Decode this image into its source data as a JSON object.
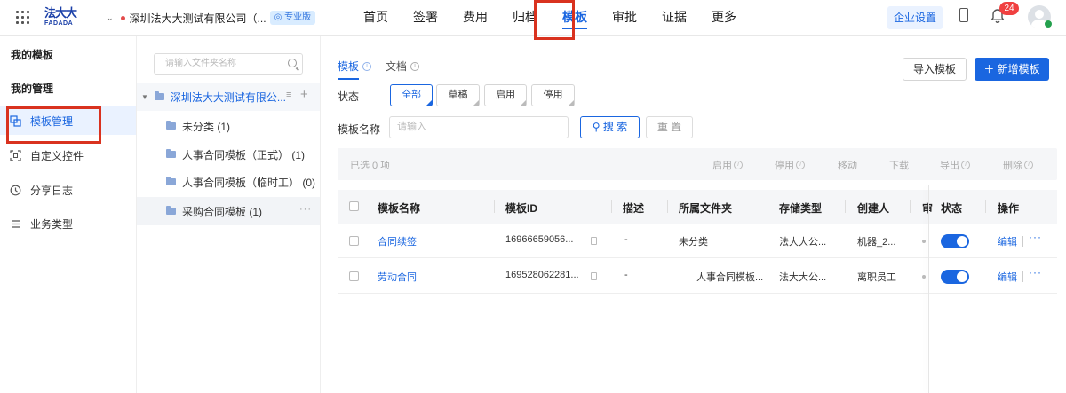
{
  "topbar": {
    "logo_cn": "法大大",
    "logo_en": "FADADA",
    "company": "深圳法大大测试有限公司（...",
    "edition": "专业版",
    "nav": [
      "首页",
      "签署",
      "费用",
      "归档",
      "模板",
      "审批",
      "证据",
      "更多"
    ],
    "active_nav": "模板",
    "enterprise_settings": "企业设置",
    "notifications": "24"
  },
  "sidebar": {
    "section1": "我的模板",
    "section2": "我的管理",
    "items": [
      {
        "label": "模板管理",
        "icon": "template-icon"
      },
      {
        "label": "自定义控件",
        "icon": "scan-icon"
      },
      {
        "label": "分享日志",
        "icon": "clock-icon"
      },
      {
        "label": "业务类型",
        "icon": "list-icon"
      }
    ]
  },
  "folders": {
    "search_placeholder": "请输入文件夹名称",
    "root": "深圳法大大测试有限公...",
    "children": [
      "未分类 (1)",
      "人事合同模板（正式） (1)",
      "人事合同模板（临时工） (0)",
      "采购合同模板 (1)"
    ]
  },
  "main": {
    "tabs": [
      "模板",
      "文档"
    ],
    "import_label": "导入模板",
    "new_label": "＋ 新增模板",
    "status_label": "状态",
    "status_chips": [
      "全部",
      "草稿",
      "启用",
      "停用"
    ],
    "name_label": "模板名称",
    "name_placeholder": "请输入",
    "search_label": "搜 索",
    "reset_label": "重 置",
    "bulk": {
      "selected": "已选 0 项",
      "actions": [
        "启用",
        "停用",
        "移动",
        "下载",
        "导出",
        "删除"
      ]
    },
    "table": {
      "headers": [
        "模板名称",
        "模板ID",
        "描述",
        "所属文件夹",
        "存储类型",
        "创建人",
        "审",
        "状态",
        "操作"
      ],
      "rows": [
        {
          "name": "合同续签",
          "id": "16966659056...",
          "desc": "-",
          "folder": "未分类",
          "storage": "法大大公...",
          "creator": "机器_2...",
          "enabled": true,
          "edit": "编辑"
        },
        {
          "name": "劳动合同",
          "id": "169528062281...",
          "desc": "-",
          "folder": "人事合同模板...",
          "storage": "法大大公...",
          "creator": "离职员工",
          "enabled": true,
          "edit": "编辑"
        }
      ]
    }
  },
  "colors": {
    "accent": "#1a66e0",
    "highlight_box": "#d9321f",
    "badge": "#f04040"
  }
}
